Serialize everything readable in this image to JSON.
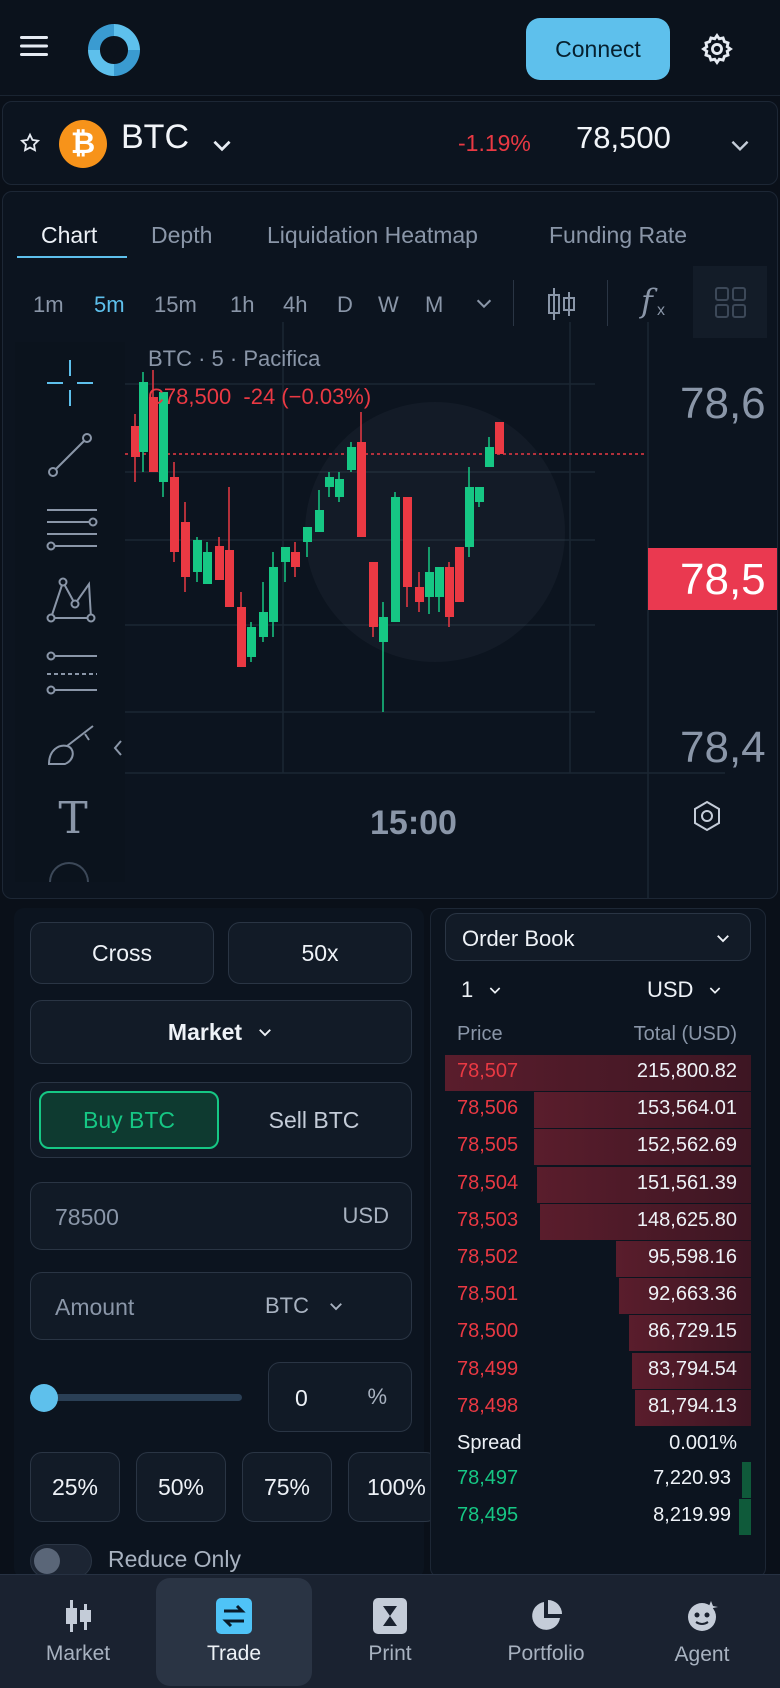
{
  "header": {
    "connect_label": "Connect"
  },
  "ticker": {
    "symbol": "BTC",
    "coin_glyph": "₿",
    "change": "-1.19%",
    "price": "78,500"
  },
  "chart_tabs": [
    "Chart",
    "Depth",
    "Liquidation Heatmap",
    "Funding Rate"
  ],
  "timeframes": [
    "1m",
    "5m",
    "15m",
    "1h",
    "4h",
    "D",
    "W",
    "M"
  ],
  "chart": {
    "legend_title": "BTC · 5 · Pacifica",
    "legend_values": "C78,500  -24 (−0.03%)",
    "price_top": "78,6",
    "price_tag": "78,5",
    "price_bottom": "78,4",
    "time_label": "15:00",
    "function_glyph": "f",
    "function_sub": "x",
    "text_tool_glyph": "T"
  },
  "trade_form": {
    "margin_mode": "Cross",
    "leverage": "50x",
    "order_type": "Market",
    "buy_label": "Buy BTC",
    "sell_label": "Sell BTC",
    "price_value": "78500",
    "price_unit": "USD",
    "amount_placeholder": "Amount",
    "amount_unit": "BTC",
    "percent_value": "0",
    "percent_sign": "%",
    "slider_fraction": 0,
    "presets": [
      "25%",
      "50%",
      "75%",
      "100%"
    ],
    "reduce_only": "Reduce Only"
  },
  "order_book": {
    "title": "Order Book",
    "tick": "1",
    "currency": "USD",
    "col_price": "Price",
    "col_total": "Total (USD)",
    "asks": [
      {
        "price": "78,507",
        "total": "215,800.82",
        "depth": 1.0
      },
      {
        "price": "78,506",
        "total": "153,564.01",
        "depth": 0.71
      },
      {
        "price": "78,505",
        "total": "152,562.69",
        "depth": 0.71
      },
      {
        "price": "78,504",
        "total": "151,561.39",
        "depth": 0.7
      },
      {
        "price": "78,503",
        "total": "148,625.80",
        "depth": 0.69
      },
      {
        "price": "78,502",
        "total": "95,598.16",
        "depth": 0.44
      },
      {
        "price": "78,501",
        "total": "92,663.36",
        "depth": 0.43
      },
      {
        "price": "78,500",
        "total": "86,729.15",
        "depth": 0.4
      },
      {
        "price": "78,499",
        "total": "83,794.54",
        "depth": 0.39
      },
      {
        "price": "78,498",
        "total": "81,794.13",
        "depth": 0.38
      }
    ],
    "spread_label": "Spread",
    "spread_value": "0.001%",
    "bids": [
      {
        "price": "78,497",
        "total": "7,220.93",
        "depth": 0.03
      },
      {
        "price": "78,495",
        "total": "8,219.99",
        "depth": 0.04
      }
    ]
  },
  "nav": [
    {
      "label": "Market",
      "icon": "market-candles-icon"
    },
    {
      "label": "Trade",
      "icon": "trade-swap-icon"
    },
    {
      "label": "Print",
      "icon": "hourglass-icon"
    },
    {
      "label": "Portfolio",
      "icon": "pie-chart-icon"
    },
    {
      "label": "Agent",
      "icon": "agent-icon"
    }
  ],
  "colors": {
    "accent": "#5ec0ec",
    "up": "#16c784",
    "down": "#ea3943",
    "bg": "#0a1019"
  }
}
